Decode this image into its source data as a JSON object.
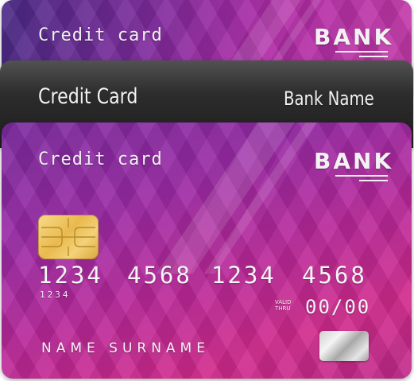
{
  "back_card": {
    "title": "Credit card",
    "bank": "BANK"
  },
  "middle_card": {
    "title": "Credit Card",
    "bank_name": "Bank Name"
  },
  "front_card": {
    "title": "Credit card",
    "bank": "BANK",
    "number_groups": [
      "1234",
      "4568",
      "1234",
      "4568"
    ],
    "number_small": "1234",
    "valid_thru": [
      "VALID",
      "THRU"
    ],
    "expiry": "00/00",
    "holder_name": "NAME SURNAME"
  },
  "colors": {
    "front_card_accent": "#c0288e",
    "back_card_accent": "#7d2a9c",
    "middle_card": "#2a2a2a",
    "chip": "#e9b94e",
    "text": "#f2f2f2"
  },
  "icons": [
    "chip-icon",
    "hologram-icon"
  ]
}
